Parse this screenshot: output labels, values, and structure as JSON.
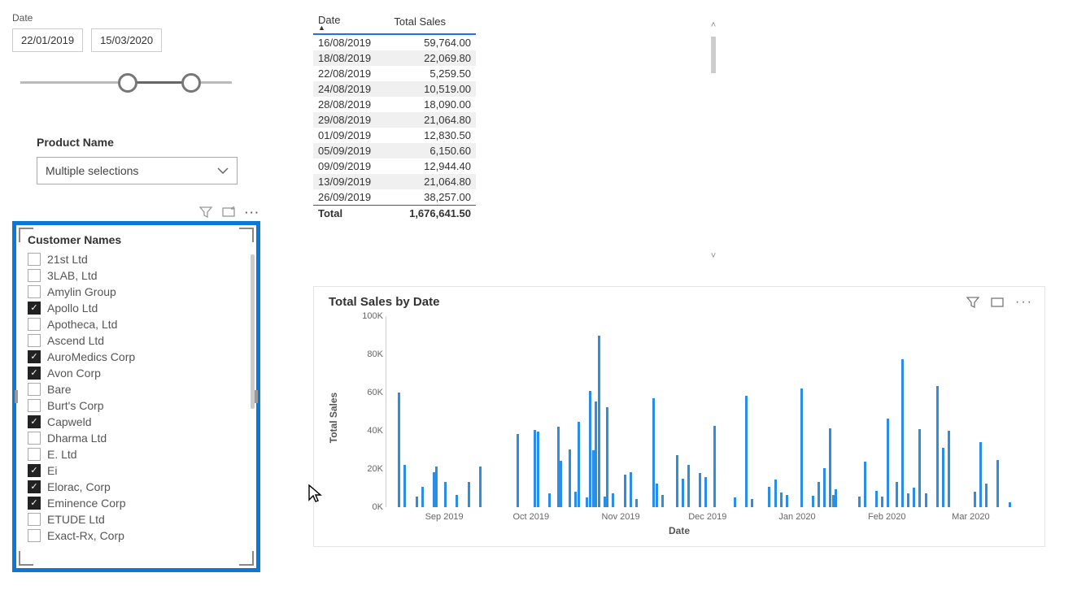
{
  "date_slicer": {
    "label": "Date",
    "from": "22/01/2019",
    "to": "15/03/2020"
  },
  "product_slicer": {
    "label": "Product Name",
    "selected_text": "Multiple selections"
  },
  "customer_slicer": {
    "title": "Customer Names",
    "items": [
      {
        "label": "21st Ltd",
        "checked": false
      },
      {
        "label": "3LAB, Ltd",
        "checked": false
      },
      {
        "label": "Amylin Group",
        "checked": false
      },
      {
        "label": "Apollo Ltd",
        "checked": true
      },
      {
        "label": "Apotheca, Ltd",
        "checked": false
      },
      {
        "label": "Ascend Ltd",
        "checked": false
      },
      {
        "label": "AuroMedics Corp",
        "checked": true
      },
      {
        "label": "Avon Corp",
        "checked": true
      },
      {
        "label": "Bare",
        "checked": false
      },
      {
        "label": "Burt's Corp",
        "checked": false
      },
      {
        "label": "Capweld",
        "checked": true
      },
      {
        "label": "Dharma Ltd",
        "checked": false
      },
      {
        "label": "E. Ltd",
        "checked": false
      },
      {
        "label": "Ei",
        "checked": true
      },
      {
        "label": "Elorac, Corp",
        "checked": true
      },
      {
        "label": "Eminence Corp",
        "checked": true
      },
      {
        "label": "ETUDE Ltd",
        "checked": false
      },
      {
        "label": "Exact-Rx, Corp",
        "checked": false
      }
    ]
  },
  "table": {
    "headers": [
      "Date",
      "Total Sales"
    ],
    "rows": [
      [
        "16/08/2019",
        "59,764.00"
      ],
      [
        "18/08/2019",
        "22,069.80"
      ],
      [
        "22/08/2019",
        "5,259.50"
      ],
      [
        "24/08/2019",
        "10,519.00"
      ],
      [
        "28/08/2019",
        "18,090.00"
      ],
      [
        "29/08/2019",
        "21,064.80"
      ],
      [
        "01/09/2019",
        "12,830.50"
      ],
      [
        "05/09/2019",
        "6,150.60"
      ],
      [
        "09/09/2019",
        "12,944.40"
      ],
      [
        "13/09/2019",
        "21,064.80"
      ],
      [
        "26/09/2019",
        "38,257.00"
      ]
    ],
    "total_label": "Total",
    "total_value": "1,676,641.50"
  },
  "chart": {
    "title": "Total Sales by Date",
    "y_label": "Total Sales",
    "x_label": "Date"
  },
  "chart_data": {
    "type": "bar",
    "title": "Total Sales by Date",
    "xlabel": "Date",
    "ylabel": "Total Sales",
    "ylim": [
      0,
      100000
    ],
    "y_ticks": [
      0,
      20000,
      40000,
      60000,
      80000,
      100000
    ],
    "y_tick_labels": [
      "0K",
      "20K",
      "40K",
      "60K",
      "80K",
      "100K"
    ],
    "x_tick_labels": [
      "Sep 2019",
      "Oct 2019",
      "Nov 2019",
      "Dec 2019",
      "Jan 2020",
      "Feb 2020",
      "Mar 2020"
    ],
    "categories": [
      "16/08/2019",
      "18/08/2019",
      "22/08/2019",
      "24/08/2019",
      "28/08/2019",
      "29/08/2019",
      "01/09/2019",
      "05/09/2019",
      "09/09/2019",
      "13/09/2019",
      "26/09/2019",
      "02/10/2019",
      "03/10/2019",
      "07/10/2019",
      "10/10/2019",
      "11/10/2019",
      "14/10/2019",
      "16/10/2019",
      "17/10/2019",
      "20/10/2019",
      "21/10/2019",
      "22/10/2019",
      "23/10/2019",
      "24/10/2019",
      "26/10/2019",
      "27/10/2019",
      "29/10/2019",
      "02/11/2019",
      "04/11/2019",
      "06/11/2019",
      "12/11/2019",
      "13/11/2019",
      "15/11/2019",
      "20/11/2019",
      "22/11/2019",
      "24/11/2019",
      "28/11/2019",
      "30/11/2019",
      "03/12/2019",
      "10/12/2019",
      "14/12/2019",
      "16/12/2019",
      "22/12/2019",
      "24/12/2019",
      "26/12/2019",
      "28/12/2019",
      "02/01/2020",
      "06/01/2020",
      "08/01/2020",
      "10/01/2020",
      "12/01/2020",
      "13/01/2020",
      "14/01/2020",
      "22/01/2020",
      "24/01/2020",
      "28/01/2020",
      "30/01/2020",
      "01/02/2020",
      "04/02/2020",
      "06/02/2020",
      "08/02/2020",
      "10/02/2020",
      "12/02/2020",
      "14/02/2020",
      "18/02/2020",
      "20/02/2020",
      "22/02/2020",
      "02/03/2020",
      "04/03/2020",
      "06/03/2020",
      "10/03/2020",
      "14/03/2020"
    ],
    "values": [
      59764,
      22070,
      5260,
      10519,
      18090,
      21065,
      12831,
      6151,
      12944,
      21065,
      38257,
      40200,
      39500,
      7100,
      41800,
      24000,
      30000,
      8000,
      44300,
      4800,
      60800,
      29500,
      55000,
      89500,
      5200,
      52000,
      7000,
      16800,
      18300,
      4000,
      56800,
      12300,
      6100,
      27200,
      14500,
      22000,
      17800,
      15400,
      42400,
      5000,
      58200,
      4200,
      10500,
      14200,
      7400,
      6000,
      61800,
      5600,
      12800,
      20300,
      41000,
      6200,
      9100,
      5400,
      23600,
      8300,
      5200,
      46100,
      13000,
      77300,
      7000,
      9800,
      40500,
      6900,
      63000,
      30800,
      40000,
      8000,
      33700,
      12000,
      24600,
      2500
    ]
  }
}
